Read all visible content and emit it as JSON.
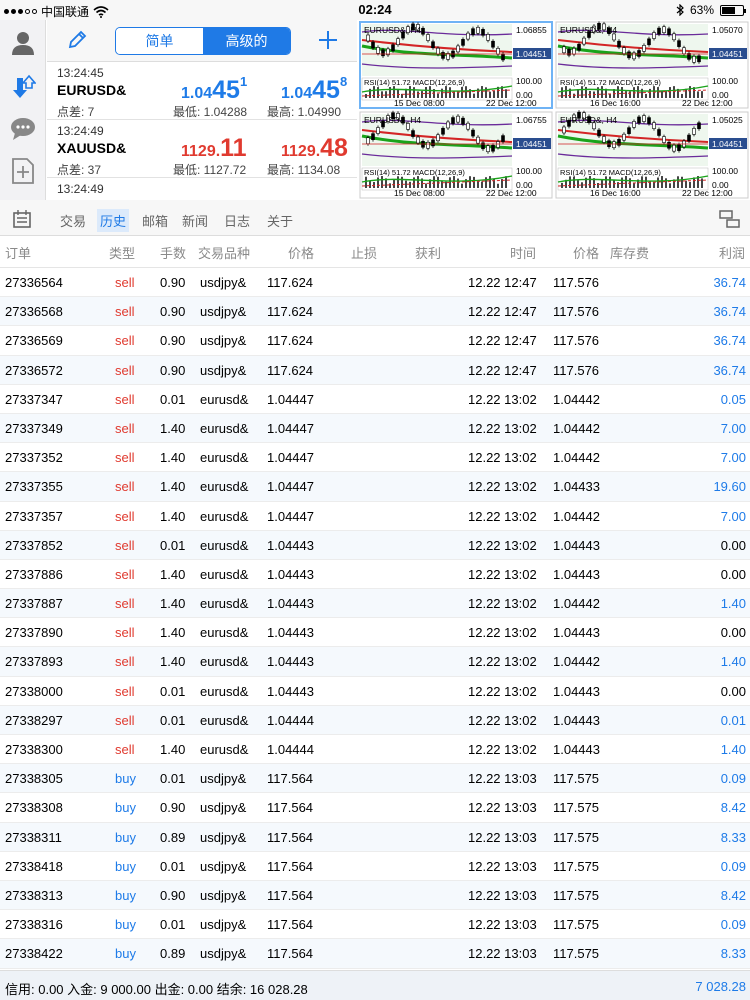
{
  "status_bar": {
    "carrier": "中国联通",
    "time": "02:24",
    "battery": "63%"
  },
  "toolbar": {
    "simple_label": "简单",
    "advanced_label": "高级的"
  },
  "quotes": [
    {
      "time": "13:24:45",
      "symbol": "EURUSD&",
      "bid": {
        "small": "1.04",
        "big": "45",
        "sup": "1"
      },
      "ask": {
        "small": "1.04",
        "big": "45",
        "sup": "8"
      },
      "spread": "点差: 7",
      "low": "最低: 1.04288",
      "high": "最高: 1.04990",
      "color": "#1e7be8"
    },
    {
      "time": "13:24:49",
      "symbol": "XAUUSD&",
      "bid": {
        "small": "1129.",
        "big": "11",
        "sup": ""
      },
      "ask": {
        "small": "1129.",
        "big": "48",
        "sup": ""
      },
      "spread": "点差: 37",
      "low": "最低: 1127.72",
      "high": "最高: 1134.08",
      "color": "#e03a2f"
    },
    {
      "time": "13:24:49",
      "symbol": "",
      "bid": {
        "small": "",
        "big": "",
        "sup": ""
      },
      "ask": {
        "small": "",
        "big": "",
        "sup": ""
      },
      "spread": "",
      "low": "",
      "high": "",
      "color": "#e03a2f"
    }
  ],
  "charts": [
    {
      "title": "EURUSD&, H4",
      "price_top": "1.06855",
      "price_current": "1.04451",
      "indicator": "RSI(14) 51.72 MACD(12,26,9)",
      "level_top": "100.00",
      "level_bottom": "0.00",
      "date_left": "15 Dec 08:00",
      "date_right": "22 Dec 12:00"
    },
    {
      "title": "EURUSD&, H4",
      "price_top": "1.05070",
      "price_current": "1.04451",
      "indicator": "RSI(14) 51.72 MACD(12,26,9)",
      "level_top": "100.00",
      "level_bottom": "0.00",
      "date_left": "16 Dec 16:00",
      "date_right": "22 Dec 12:00"
    },
    {
      "title": "EURUSD&, H4",
      "price_top": "1.06755",
      "price_current": "1.04451",
      "indicator": "RSI(14) 51.72 MACD(12,26,9)",
      "level_top": "100.00",
      "level_bottom": "0.00",
      "date_left": "15 Dec 08:00",
      "date_right": "22 Dec 12:00"
    },
    {
      "title": "EURUSD&, H4",
      "price_top": "1.05025",
      "price_current": "1.04451",
      "indicator": "RSI(14) 51.72 MACD(12,26,9)",
      "level_top": "100.00",
      "level_bottom": "0.00",
      "date_left": "16 Dec 16:00",
      "date_right": "22 Dec 12:00"
    }
  ],
  "tabs": [
    {
      "label": "交易",
      "active": false
    },
    {
      "label": "历史",
      "active": true
    },
    {
      "label": "邮箱",
      "active": false
    },
    {
      "label": "新闻",
      "active": false
    },
    {
      "label": "日志",
      "active": false
    },
    {
      "label": "关于",
      "active": false
    }
  ],
  "table": {
    "headers": [
      "订单",
      "类型",
      "手数",
      "交易品种",
      "价格",
      "止损",
      "获利",
      "时间",
      "价格",
      "库存费",
      "利润"
    ],
    "rows": [
      [
        "27336564",
        "sell",
        "0.90",
        "usdjpy&",
        "117.624",
        "12.22 12:47",
        "117.576",
        "36.74"
      ],
      [
        "27336568",
        "sell",
        "0.90",
        "usdjpy&",
        "117.624",
        "12.22 12:47",
        "117.576",
        "36.74"
      ],
      [
        "27336569",
        "sell",
        "0.90",
        "usdjpy&",
        "117.624",
        "12.22 12:47",
        "117.576",
        "36.74"
      ],
      [
        "27336572",
        "sell",
        "0.90",
        "usdjpy&",
        "117.624",
        "12.22 12:47",
        "117.576",
        "36.74"
      ],
      [
        "27337347",
        "sell",
        "0.01",
        "eurusd&",
        "1.04447",
        "12.22 13:02",
        "1.04442",
        "0.05"
      ],
      [
        "27337349",
        "sell",
        "1.40",
        "eurusd&",
        "1.04447",
        "12.22 13:02",
        "1.04442",
        "7.00"
      ],
      [
        "27337352",
        "sell",
        "1.40",
        "eurusd&",
        "1.04447",
        "12.22 13:02",
        "1.04442",
        "7.00"
      ],
      [
        "27337355",
        "sell",
        "1.40",
        "eurusd&",
        "1.04447",
        "12.22 13:02",
        "1.04433",
        "19.60"
      ],
      [
        "27337357",
        "sell",
        "1.40",
        "eurusd&",
        "1.04447",
        "12.22 13:02",
        "1.04442",
        "7.00"
      ],
      [
        "27337852",
        "sell",
        "0.01",
        "eurusd&",
        "1.04443",
        "12.22 13:02",
        "1.04443",
        "0.00"
      ],
      [
        "27337886",
        "sell",
        "1.40",
        "eurusd&",
        "1.04443",
        "12.22 13:02",
        "1.04443",
        "0.00"
      ],
      [
        "27337887",
        "sell",
        "1.40",
        "eurusd&",
        "1.04443",
        "12.22 13:02",
        "1.04442",
        "1.40"
      ],
      [
        "27337890",
        "sell",
        "1.40",
        "eurusd&",
        "1.04443",
        "12.22 13:02",
        "1.04443",
        "0.00"
      ],
      [
        "27337893",
        "sell",
        "1.40",
        "eurusd&",
        "1.04443",
        "12.22 13:02",
        "1.04442",
        "1.40"
      ],
      [
        "27338000",
        "sell",
        "0.01",
        "eurusd&",
        "1.04443",
        "12.22 13:02",
        "1.04443",
        "0.00"
      ],
      [
        "27338297",
        "sell",
        "0.01",
        "eurusd&",
        "1.04444",
        "12.22 13:02",
        "1.04443",
        "0.01"
      ],
      [
        "27338300",
        "sell",
        "1.40",
        "eurusd&",
        "1.04444",
        "12.22 13:02",
        "1.04443",
        "1.40"
      ],
      [
        "27338305",
        "buy",
        "0.01",
        "usdjpy&",
        "117.564",
        "12.22 13:03",
        "117.575",
        "0.09"
      ],
      [
        "27338308",
        "buy",
        "0.90",
        "usdjpy&",
        "117.564",
        "12.22 13:03",
        "117.575",
        "8.42"
      ],
      [
        "27338311",
        "buy",
        "0.89",
        "usdjpy&",
        "117.564",
        "12.22 13:03",
        "117.575",
        "8.33"
      ],
      [
        "27338418",
        "buy",
        "0.01",
        "usdjpy&",
        "117.564",
        "12.22 13:03",
        "117.575",
        "0.09"
      ],
      [
        "27338313",
        "buy",
        "0.90",
        "usdjpy&",
        "117.564",
        "12.22 13:03",
        "117.575",
        "8.42"
      ],
      [
        "27338316",
        "buy",
        "0.01",
        "usdjpy&",
        "117.564",
        "12.22 13:03",
        "117.575",
        "0.09"
      ],
      [
        "27338422",
        "buy",
        "0.89",
        "usdjpy&",
        "117.564",
        "12.22 13:03",
        "117.575",
        "8.33"
      ]
    ],
    "profit_colors": {
      "positive": "#1e7be8",
      "zero": "#000000"
    }
  },
  "footer": {
    "summary": "信用: 0.00 入金: 9 000.00 出金: 0.00 结余: 16 028.28",
    "total": "7 028.28"
  },
  "colors": {
    "accent": "#1f7ae6",
    "sell": "#e03a2f",
    "buy": "#1e7be8"
  },
  "icons": {
    "sidebar": [
      "account-icon",
      "trade-arrows-icon",
      "chat-icon",
      "new-order-icon"
    ],
    "header": [
      "edit-pencil-icon",
      "add-plus-icon"
    ],
    "tabbar": [
      "history-calendar-icon",
      "layout-toggle-icon"
    ]
  }
}
